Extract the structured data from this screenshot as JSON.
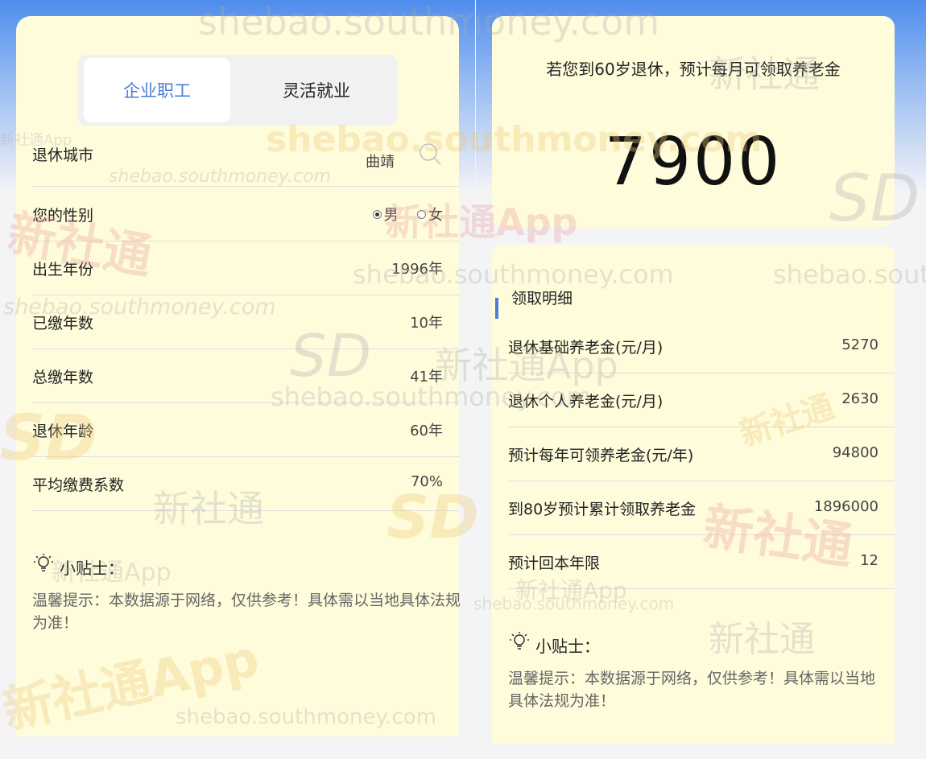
{
  "left": {
    "tabs": [
      {
        "label": "企业职工",
        "active": true
      },
      {
        "label": "灵活就业",
        "active": false
      }
    ],
    "city": {
      "label": "退休城市",
      "value": "曲靖",
      "icon": "search-icon"
    },
    "gender": {
      "label": "您的性别",
      "options": [
        {
          "label": "男",
          "checked": true
        },
        {
          "label": "女",
          "checked": false
        }
      ]
    },
    "birth_year": {
      "label": "出生年份",
      "value": "1996年"
    },
    "paid_years": {
      "label": "已缴年数",
      "value": "10年"
    },
    "total_years": {
      "label": "总缴年数",
      "value": "41年"
    },
    "retire_age": {
      "label": "退休年龄",
      "value": "60年"
    },
    "coefficient": {
      "label": "平均缴费系数",
      "value": "70%"
    },
    "tip": {
      "title": "小贴士：",
      "icon": "lightbulb-icon",
      "text": "温馨提示：本数据源于网络，仅供参考！具体需以当地具体法规为准！"
    }
  },
  "right": {
    "caption": "若您到60岁退休，预计每月可领取养老金",
    "amount": "7900",
    "detail_title": "领取明细",
    "rows": [
      {
        "label": "退休基础养老金(元/月)",
        "value": "5270"
      },
      {
        "label": "退休个人养老金(元/月)",
        "value": "2630"
      },
      {
        "label": "预计每年可领养老金(元/年)",
        "value": "94800"
      },
      {
        "label": "到80岁预计累计领取养老金",
        "value": "1896000"
      },
      {
        "label": "预计回本年限",
        "value": "12"
      }
    ],
    "tip": {
      "title": "小贴士：",
      "icon": "lightbulb-icon",
      "text": "温馨提示：本数据源于网络，仅供参考！具体需以当地具体法规为准！"
    }
  },
  "watermarks": {
    "url": "shebao.southmoney.com",
    "app": "新社通App",
    "cn": "新社通",
    "logo": "SD"
  },
  "colors": {
    "accent": "#4a7fd4",
    "card_bg": "#fffcdc",
    "header_blue": "#4f8ded"
  }
}
